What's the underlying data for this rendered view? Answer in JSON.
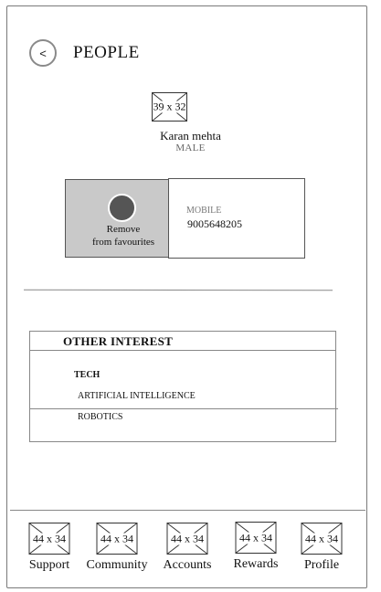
{
  "header": {
    "back_glyph": "<",
    "title": "PEOPLE"
  },
  "profile": {
    "avatar_placeholder": "39 x 32",
    "name": "Karan mehta",
    "gender": "MALE"
  },
  "contact": {
    "favourite_action_line1": "Remove",
    "favourite_action_line2": "from favourites",
    "mobile_label": "MOBILE",
    "mobile_number": "9005648205"
  },
  "interests": {
    "title": "OTHER INTEREST",
    "category": "TECH",
    "items": [
      "ARTIFICIAL INTELLIGENCE",
      "ROBOTICS"
    ]
  },
  "nav": {
    "items": [
      {
        "label": "Support",
        "placeholder": "44 x 34"
      },
      {
        "label": "Community",
        "placeholder": "44 x 34"
      },
      {
        "label": "Accounts",
        "placeholder": "44 x 34"
      },
      {
        "label": "Rewards",
        "placeholder": "44 x 34"
      },
      {
        "label": "Profile",
        "placeholder": "44 x 34"
      }
    ]
  }
}
